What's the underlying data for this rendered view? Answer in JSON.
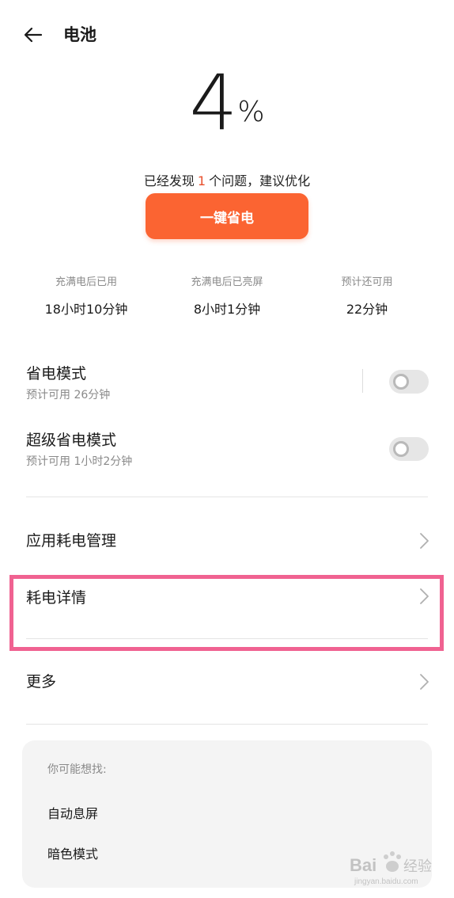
{
  "header": {
    "title": "电池",
    "back_icon": "arrow-left-icon"
  },
  "battery": {
    "percent": "4",
    "unit": "%",
    "issue_prefix": "已经发现",
    "issue_count": "1",
    "issue_suffix": "个问题，建议优化",
    "optimize_button": "一键省电"
  },
  "stats": [
    {
      "label": "充满电后已用",
      "value": "18小时10分钟"
    },
    {
      "label": "充满电后已亮屏",
      "value": "8小时1分钟"
    },
    {
      "label": "预计还可用",
      "value": "22分钟"
    }
  ],
  "modes": [
    {
      "title": "省电模式",
      "subtitle": "预计可用 26分钟",
      "enabled": false
    },
    {
      "title": "超级省电模式",
      "subtitle": "预计可用 1小时2分钟",
      "enabled": false
    }
  ],
  "nav_rows": [
    {
      "title": "应用耗电管理",
      "icon": "chevron-right-icon"
    },
    {
      "title": "耗电详情",
      "icon": "chevron-right-icon"
    },
    {
      "title": "更多",
      "icon": "chevron-right-icon"
    }
  ],
  "suggestions": {
    "heading": "你可能想找:",
    "items": [
      "自动息屏",
      "暗色模式"
    ]
  },
  "watermark": {
    "logo": "baidu-jingyan-logo",
    "text": "Bai 经验",
    "url": "jingyan.baidu.com"
  },
  "colors": {
    "accent": "#fb6432",
    "issue_count": "#e8502d",
    "highlight": "#f06291"
  }
}
